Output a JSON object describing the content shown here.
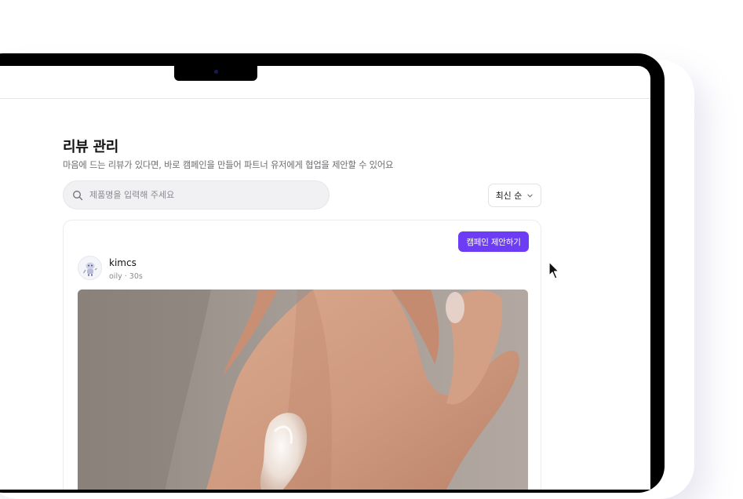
{
  "page": {
    "title": "리뷰 관리",
    "subtitle": "마음에 드는 리뷰가 있다면, 바로 캠페인을 만들어 파트너 유저에게 협업을 제안할 수 있어요"
  },
  "search": {
    "placeholder": "제품명을 입력해 주세요",
    "value": "",
    "icon": "search-icon"
  },
  "sort": {
    "selected": "최신 순",
    "icon": "chevron-down-icon"
  },
  "review_card": {
    "campaign_button": "캠페인 제안하기",
    "user": {
      "name": "kimcs",
      "meta": "oily · 30s"
    },
    "photo": "hand-with-cream-photo"
  },
  "colors": {
    "accent": "#6d3cf5",
    "text_primary": "#111111",
    "text_secondary": "#6b6b70",
    "search_bg": "#f1f1f3",
    "bezel": "#000000"
  }
}
